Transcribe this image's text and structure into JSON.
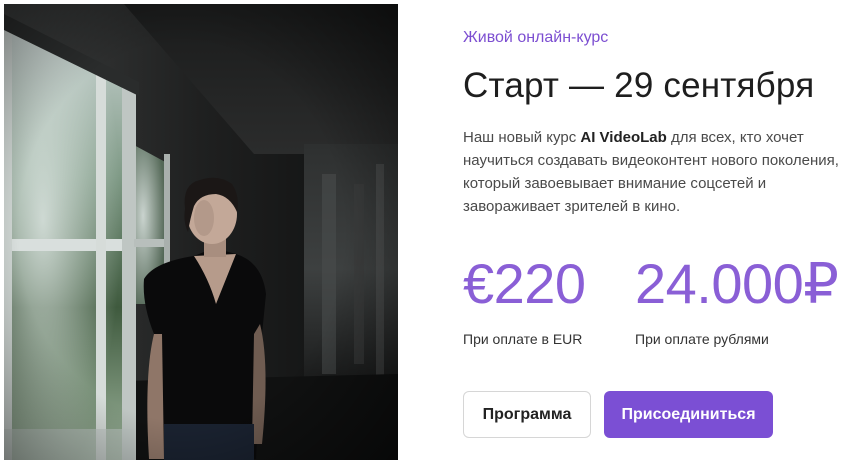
{
  "hero": {
    "image_alt": "Женщина у окна в полутёмной комнате"
  },
  "course": {
    "eyebrow": "Живой онлайн-курс",
    "title": "Старт — 29 сентября",
    "description": {
      "before": "Наш новый курс ",
      "highlight": "AI VideoLab",
      "after": " для всех, кто хочет научиться создавать видеоконтент нового поколения, который завоевывает внимание соцсетей и завораживает зрителей в кино."
    }
  },
  "prices": [
    {
      "value": "€220",
      "caption": "При оплате в EUR"
    },
    {
      "value": "24.000₽",
      "caption": "При оплате рублями"
    }
  ],
  "buttons": {
    "program_label": "Программа",
    "join_label": "Присоединиться"
  },
  "colors": {
    "accent": "#7b4fd4",
    "price": "#8a5fd6",
    "title": "#1e1e1e",
    "body_text": "#4a4a4a"
  }
}
